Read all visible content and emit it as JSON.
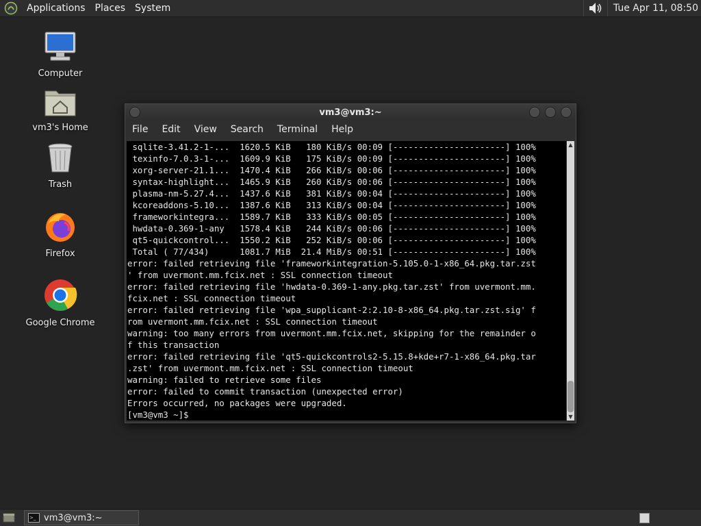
{
  "top_panel": {
    "menus": [
      "Applications",
      "Places",
      "System"
    ],
    "clock": "Tue Apr 11, 08:50"
  },
  "desktop": {
    "icons": [
      {
        "label": "Computer"
      },
      {
        "label": "vm3's Home"
      },
      {
        "label": "Trash"
      },
      {
        "label": "Firefox"
      },
      {
        "label": "Google Chrome"
      }
    ]
  },
  "terminal": {
    "title": "vm3@vm3:~",
    "menus": [
      "File",
      "Edit",
      "View",
      "Search",
      "Terminal",
      "Help"
    ],
    "lines": [
      " sqlite-3.41.2-1-...  1620.5 KiB   180 KiB/s 00:09 [----------------------] 100%",
      " texinfo-7.0.3-1-...  1609.9 KiB   175 KiB/s 00:09 [----------------------] 100%",
      " xorg-server-21.1...  1470.4 KiB   266 KiB/s 00:06 [----------------------] 100%",
      " syntax-highlight...  1465.9 KiB   260 KiB/s 00:06 [----------------------] 100%",
      " plasma-nm-5.27.4...  1437.6 KiB   381 KiB/s 00:04 [----------------------] 100%",
      " kcoreaddons-5.10...  1387.6 KiB   313 KiB/s 00:04 [----------------------] 100%",
      " frameworkintegra...  1589.7 KiB   333 KiB/s 00:05 [----------------------] 100%",
      " hwdata-0.369-1-any   1578.4 KiB   244 KiB/s 00:06 [----------------------] 100%",
      " qt5-quickcontrol...  1550.2 KiB   252 KiB/s 00:06 [----------------------] 100%",
      " Total ( 77/434)      1081.7 MiB  21.4 MiB/s 00:51 [----------------------] 100%",
      "error: failed retrieving file 'frameworkintegration-5.105.0-1-x86_64.pkg.tar.zst",
      "' from uvermont.mm.fcix.net : SSL connection timeout",
      "error: failed retrieving file 'hwdata-0.369-1-any.pkg.tar.zst' from uvermont.mm.",
      "fcix.net : SSL connection timeout",
      "error: failed retrieving file 'wpa_supplicant-2:2.10-8-x86_64.pkg.tar.zst.sig' f",
      "rom uvermont.mm.fcix.net : SSL connection timeout",
      "warning: too many errors from uvermont.mm.fcix.net, skipping for the remainder o",
      "f this transaction",
      "error: failed retrieving file 'qt5-quickcontrols2-5.15.8+kde+r7-1-x86_64.pkg.tar",
      ".zst' from uvermont.mm.fcix.net : SSL connection timeout",
      "warning: failed to retrieve some files",
      "error: failed to commit transaction (unexpected error)",
      "Errors occurred, no packages were upgraded.",
      "[vm3@vm3 ~]$ "
    ]
  },
  "taskbar": {
    "window_button": "vm3@vm3:~"
  }
}
